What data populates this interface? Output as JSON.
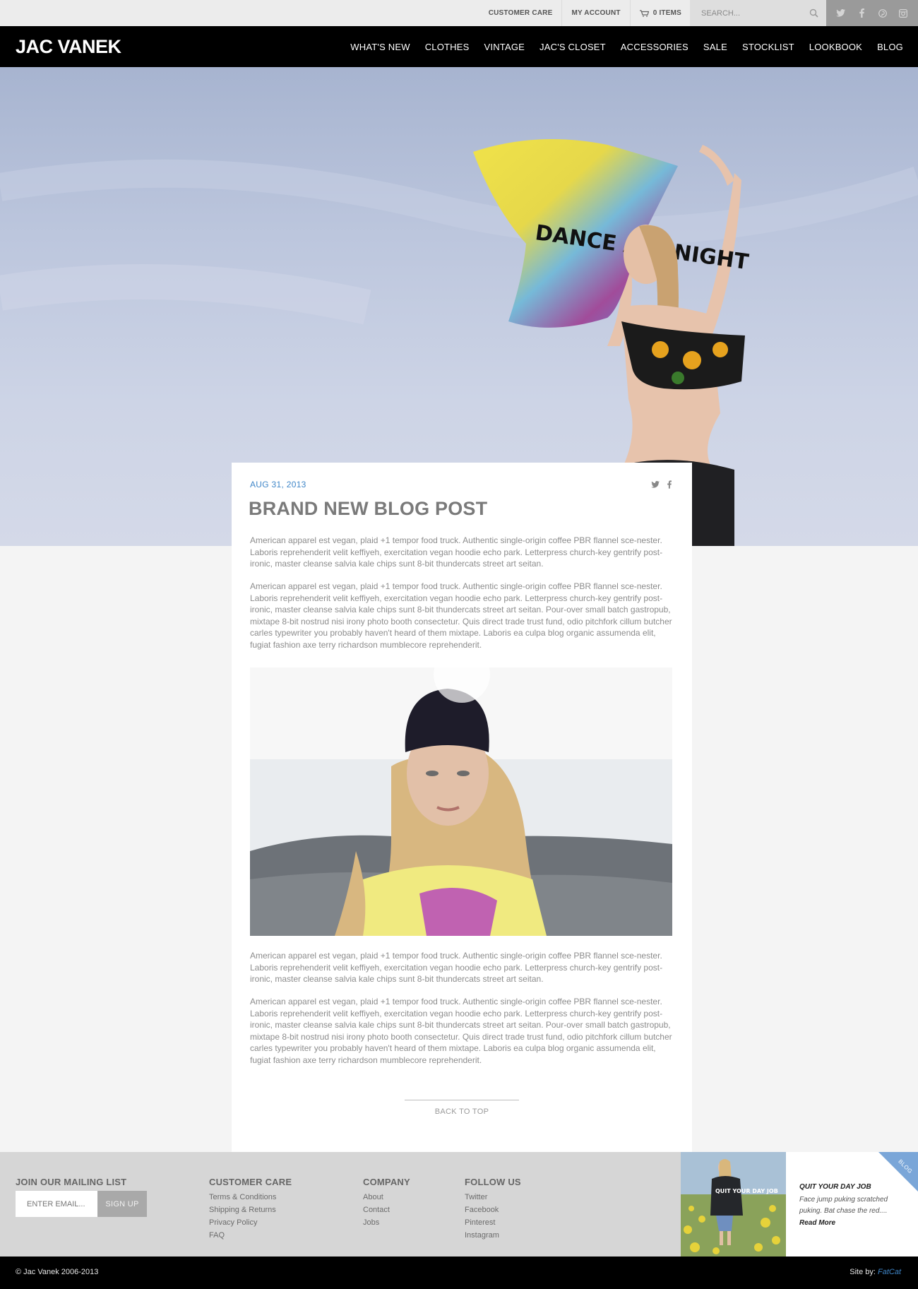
{
  "utility_bar": {
    "customer_care": "CUSTOMER CARE",
    "my_account": "MY ACCOUNT",
    "cart": "0 ITEMS",
    "search_placeholder": "SEARCH...",
    "social_icons": [
      "twitter-icon",
      "facebook-icon",
      "pinterest-icon",
      "instagram-icon"
    ]
  },
  "header": {
    "logo": "JAC VANEK",
    "nav": [
      "WHAT'S NEW",
      "CLOTHES",
      "VINTAGE",
      "JAC'S CLOSET",
      "ACCESSORIES",
      "SALE",
      "STOCKLIST",
      "LOOKBOOK",
      "BLOG"
    ]
  },
  "hero": {
    "shirt_text": "DANCE ALL NIGHT"
  },
  "post": {
    "date": "AUG 31, 2013",
    "title": "BRAND NEW BLOG POST",
    "share_icons": [
      "twitter-icon",
      "facebook-icon"
    ],
    "paragraphs": [
      "American apparel est vegan, plaid +1 tempor food truck. Authentic single-origin coffee PBR flannel sce-nester. Laboris reprehenderit velit keffiyeh, exercitation vegan hoodie echo park. Letterpress church-key gentrify post-ironic, master cleanse salvia kale chips sunt 8-bit thundercats street art seitan.",
      "American apparel est vegan, plaid +1 tempor food truck. Authentic single-origin coffee PBR flannel sce-nester. Laboris reprehenderit velit keffiyeh, exercitation vegan hoodie echo park. Letterpress church-key gentrify post-ironic, master cleanse salvia kale chips sunt 8-bit thundercats street art seitan. Pour-over small batch gastropub, mixtape 8-bit nostrud nisi irony photo booth consectetur. Quis direct trade trust fund, odio pitchfork cillum butcher carles typewriter you probably haven't heard of them mixtape. Laboris ea culpa blog organic assumenda elit, fugiat fashion axe terry richardson mumblecore reprehenderit.",
      "American apparel est vegan, plaid +1 tempor food truck. Authentic single-origin coffee PBR flannel sce-nester. Laboris reprehenderit velit keffiyeh, exercitation vegan hoodie echo park. Letterpress church-key gentrify post-ironic, master cleanse salvia kale chips sunt 8-bit thundercats street art seitan.",
      "American apparel est vegan, plaid +1 tempor food truck. Authentic single-origin coffee PBR flannel sce-nester. Laboris reprehenderit velit keffiyeh, exercitation vegan hoodie echo park. Letterpress church-key gentrify post-ironic, master cleanse salvia kale chips sunt 8-bit thundercats street art seitan. Pour-over small batch gastropub, mixtape 8-bit nostrud nisi irony photo booth consectetur. Quis direct trade trust fund, odio pitchfork cillum butcher carles typewriter you probably haven't heard of them mixtape. Laboris ea culpa blog organic assumenda elit, fugiat fashion axe terry richardson mumblecore reprehenderit."
    ],
    "back_to_top": "BACK TO TOP"
  },
  "footer": {
    "mailing": {
      "heading": "JOIN OUR MAILING LIST",
      "placeholder": "ENTER EMAIL...",
      "button": "SIGN UP"
    },
    "customer_care": {
      "heading": "CUSTOMER CARE",
      "links": [
        "Terms & Conditions",
        "Shipping & Returns",
        "Privacy Policy",
        "FAQ"
      ]
    },
    "company": {
      "heading": "COMPANY",
      "links": [
        "About",
        "Contact",
        "Jobs"
      ]
    },
    "follow": {
      "heading": "FOLLOW US",
      "links": [
        "Twitter",
        "Facebook",
        "Pinterest",
        "Instagram"
      ]
    },
    "promo": {
      "ribbon": "BLOG",
      "title": "QUIT YOUR DAY JOB",
      "text": "Face jump puking scratched puking. Bat chase the red....",
      "link": "Read More",
      "shirt_text": "QUIT YOUR DAY JOB"
    },
    "copyright": "© Jac Vanek 2006-2013",
    "site_by_label": "Site by: ",
    "site_by_name": "FatCat"
  },
  "colors": {
    "accent": "#3f86c8",
    "nav_bg": "#000000",
    "footer_bg": "#d6d6d6",
    "utility_bg": "#ececec"
  }
}
